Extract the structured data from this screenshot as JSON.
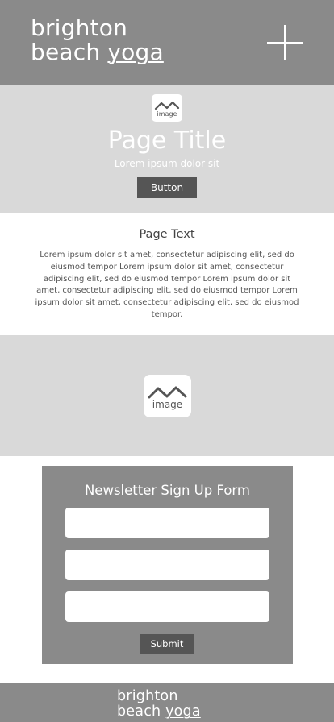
{
  "header": {
    "logo": {
      "line1": "brighton",
      "line2_prefix": "beach ",
      "line2_underlined": "yoga"
    },
    "menu_icon": "plus-icon"
  },
  "hero": {
    "image_icon_label": "image",
    "title": "Page Title",
    "subtitle": "Lorem ipsum dolor sit",
    "button_label": "Button"
  },
  "text_section": {
    "heading": "Page Text",
    "body": "Lorem ipsum dolor sit amet, consectetur adipiscing elit, sed do eiusmod tempor Lorem ipsum dolor sit amet, consectetur adipiscing elit, sed do eiusmod tempor Lorem ipsum dolor sit amet, consectetur adipiscing elit, sed do eiusmod tempor Lorem ipsum dolor sit amet, consectetur adipiscing elit, sed do eiusmod tempor."
  },
  "image_block": {
    "image_icon_label": "image"
  },
  "newsletter": {
    "title": "Newsletter Sign Up Form",
    "inputs": [
      {
        "value": "",
        "placeholder": ""
      },
      {
        "value": "",
        "placeholder": ""
      },
      {
        "value": "",
        "placeholder": ""
      }
    ],
    "submit_label": "Submit"
  },
  "footer": {
    "logo": {
      "line1": "brighton",
      "line2_prefix": "beach ",
      "line2_underlined": "yoga"
    }
  },
  "colors": {
    "header_bg": "#8a8a8a",
    "section_bg": "#d9d9d9",
    "button_bg": "#555555",
    "text": "#555555"
  }
}
